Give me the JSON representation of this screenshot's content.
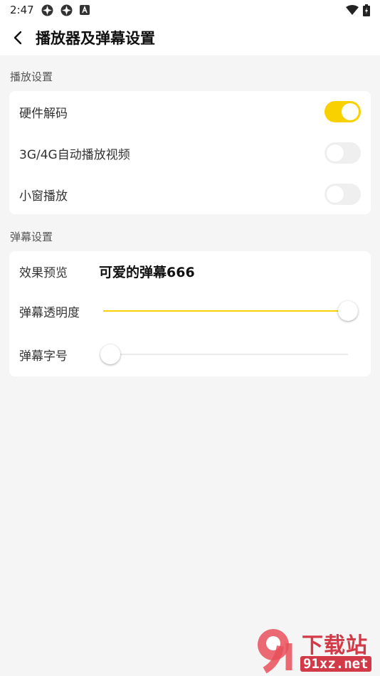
{
  "status_bar": {
    "time": "2:47"
  },
  "header": {
    "title": "播放器及弹幕设置"
  },
  "playback_section": {
    "label": "播放设置",
    "items": [
      {
        "label": "硬件解码",
        "enabled": true
      },
      {
        "label": "3G/4G自动播放视频",
        "enabled": false
      },
      {
        "label": "小窗播放",
        "enabled": false
      }
    ]
  },
  "danmaku_section": {
    "label": "弹幕设置",
    "preview_label": "效果预览",
    "preview_text": "可爱的弹幕666",
    "opacity_label": "弹幕透明度",
    "opacity_value": 1.0,
    "font_size_label": "弹幕字号",
    "font_size_value": 0.0
  },
  "watermark": {
    "text": "下载站",
    "domain": "91xz.net"
  },
  "colors": {
    "accent": "#f9d000",
    "background": "#f5f5f5",
    "card": "#ffffff"
  }
}
